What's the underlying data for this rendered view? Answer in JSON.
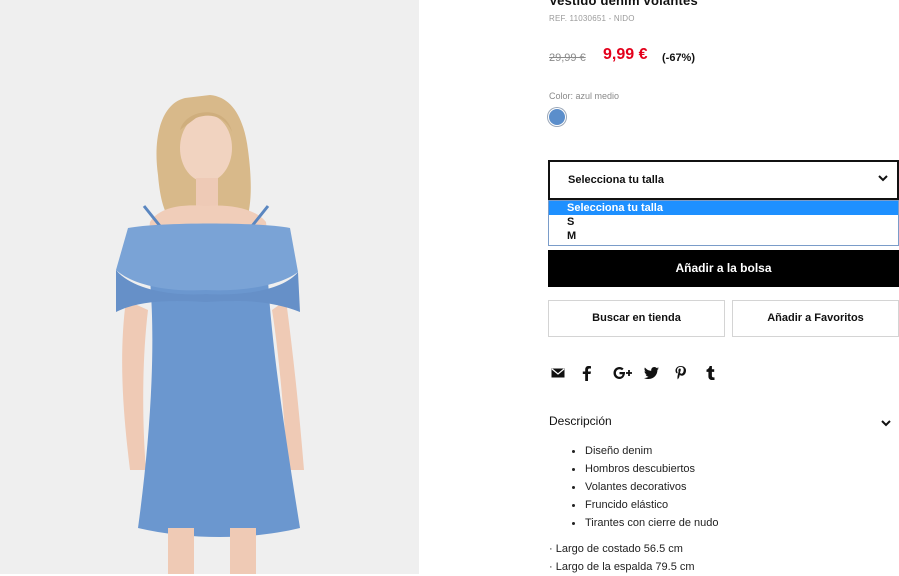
{
  "product": {
    "title": "Vestido denim volantes",
    "ref": "REF. 11030651 - NIDO",
    "old_price": "29,99 €",
    "new_price": "9,99 €",
    "discount": "(-67%)",
    "color_label": "Color: azul medio",
    "swatch_color": "#5b8ecb"
  },
  "size": {
    "select_label": "Selecciona tu talla",
    "options": [
      "Selecciona tu talla",
      "S",
      "M"
    ]
  },
  "actions": {
    "add_to_bag": "Añadir a la bolsa",
    "find_in_store": "Buscar en tienda",
    "add_favorites": "Añadir a Favoritos"
  },
  "share_icons": [
    "mail-icon",
    "facebook-icon",
    "google-plus-icon",
    "twitter-icon",
    "pinterest-icon",
    "tumblr-icon"
  ],
  "description": {
    "heading": "Descripción",
    "bullets": [
      "Diseño denim",
      "Hombros descubiertos",
      "Volantes decorativos",
      "Fruncido elástico",
      "Tirantes con cierre de nudo"
    ],
    "measures": [
      "· Largo de costado 56.5 cm",
      "· Largo de la espalda 79.5 cm"
    ]
  }
}
